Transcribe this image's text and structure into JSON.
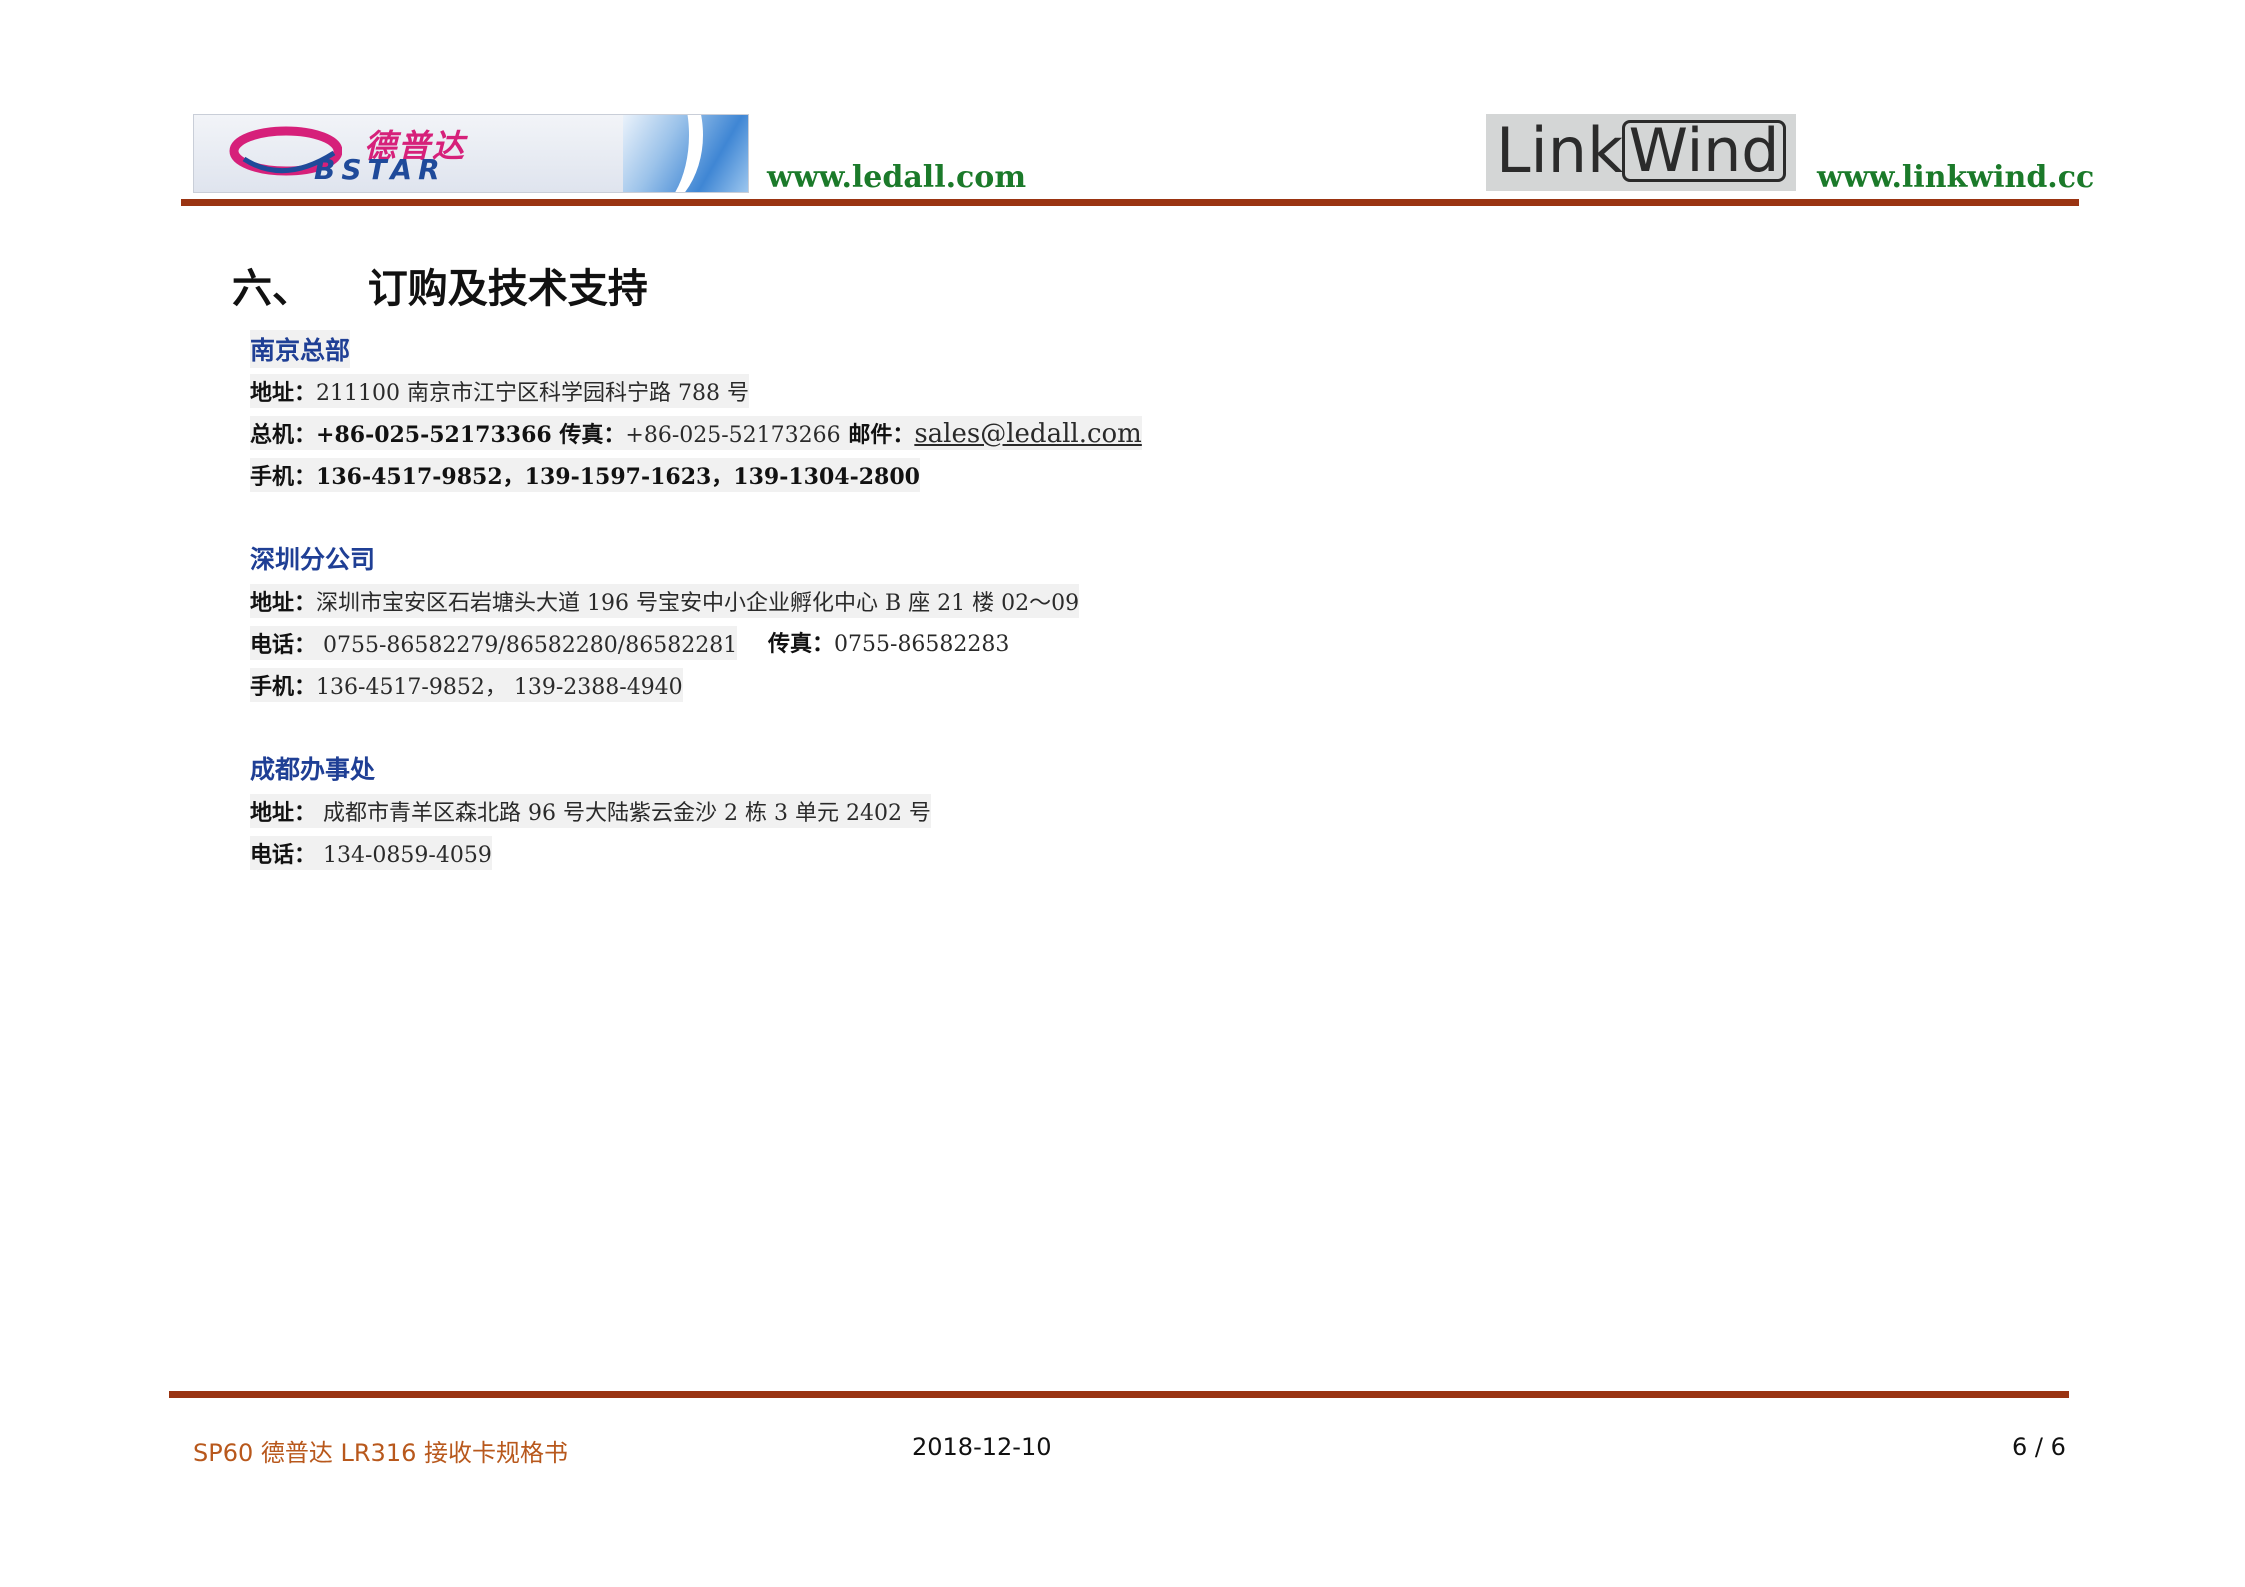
{
  "header": {
    "bstar_logo_cn": "德普达",
    "bstar_logo_en": "BSTAR",
    "left_url": "www.ledall.com",
    "linkwind_logo_link": "Link",
    "linkwind_logo_wind": "Wind",
    "right_url": "www.linkwind.cc",
    "accent_color": "#9a3412",
    "url_color": "#1b7a2a"
  },
  "section": {
    "title": "六、    订购及技术支持"
  },
  "offices": {
    "nanjing": {
      "name": "南京总部",
      "address_label": "地址：",
      "address": "211100 南京市江宁区科学园科宁路 788 号",
      "phone_label": "总机：",
      "phone": "+86-025-52173366",
      "fax_label": " 传真：",
      "fax": "+86-025-52173266",
      "email_label": " 邮件：",
      "email": "sales@ledall.com",
      "mobile_label": "手机：",
      "mobile": "136-4517-9852，139-1597-1623，139-1304-2800"
    },
    "shenzhen": {
      "name": "深圳分公司",
      "address_label": "地址：",
      "address": "深圳市宝安区石岩塘头大道 196 号宝安中小企业孵化中心 B 座 21 楼 02～09",
      "phone_label": "电话：",
      "phone": " 0755-86582279/86582280/86582281",
      "fax_label": "传真：",
      "fax": "0755-86582283",
      "mobile_label": "手机：",
      "mobile": "136-4517-9852，  139-2388-4940"
    },
    "chengdu": {
      "name": "成都办事处",
      "address_label": "地址：",
      "address": " 成都市青羊区森北路 96 号大陆紫云金沙 2 栋 3 单元 2402 号",
      "phone_label": "电话：",
      "phone": "  134-0859-4059"
    }
  },
  "footer": {
    "doc_title": "SP60  德普达 LR316 接收卡规格书",
    "date": "2018-12-10",
    "page": "6 / 6",
    "title_color": "#b8581c"
  }
}
